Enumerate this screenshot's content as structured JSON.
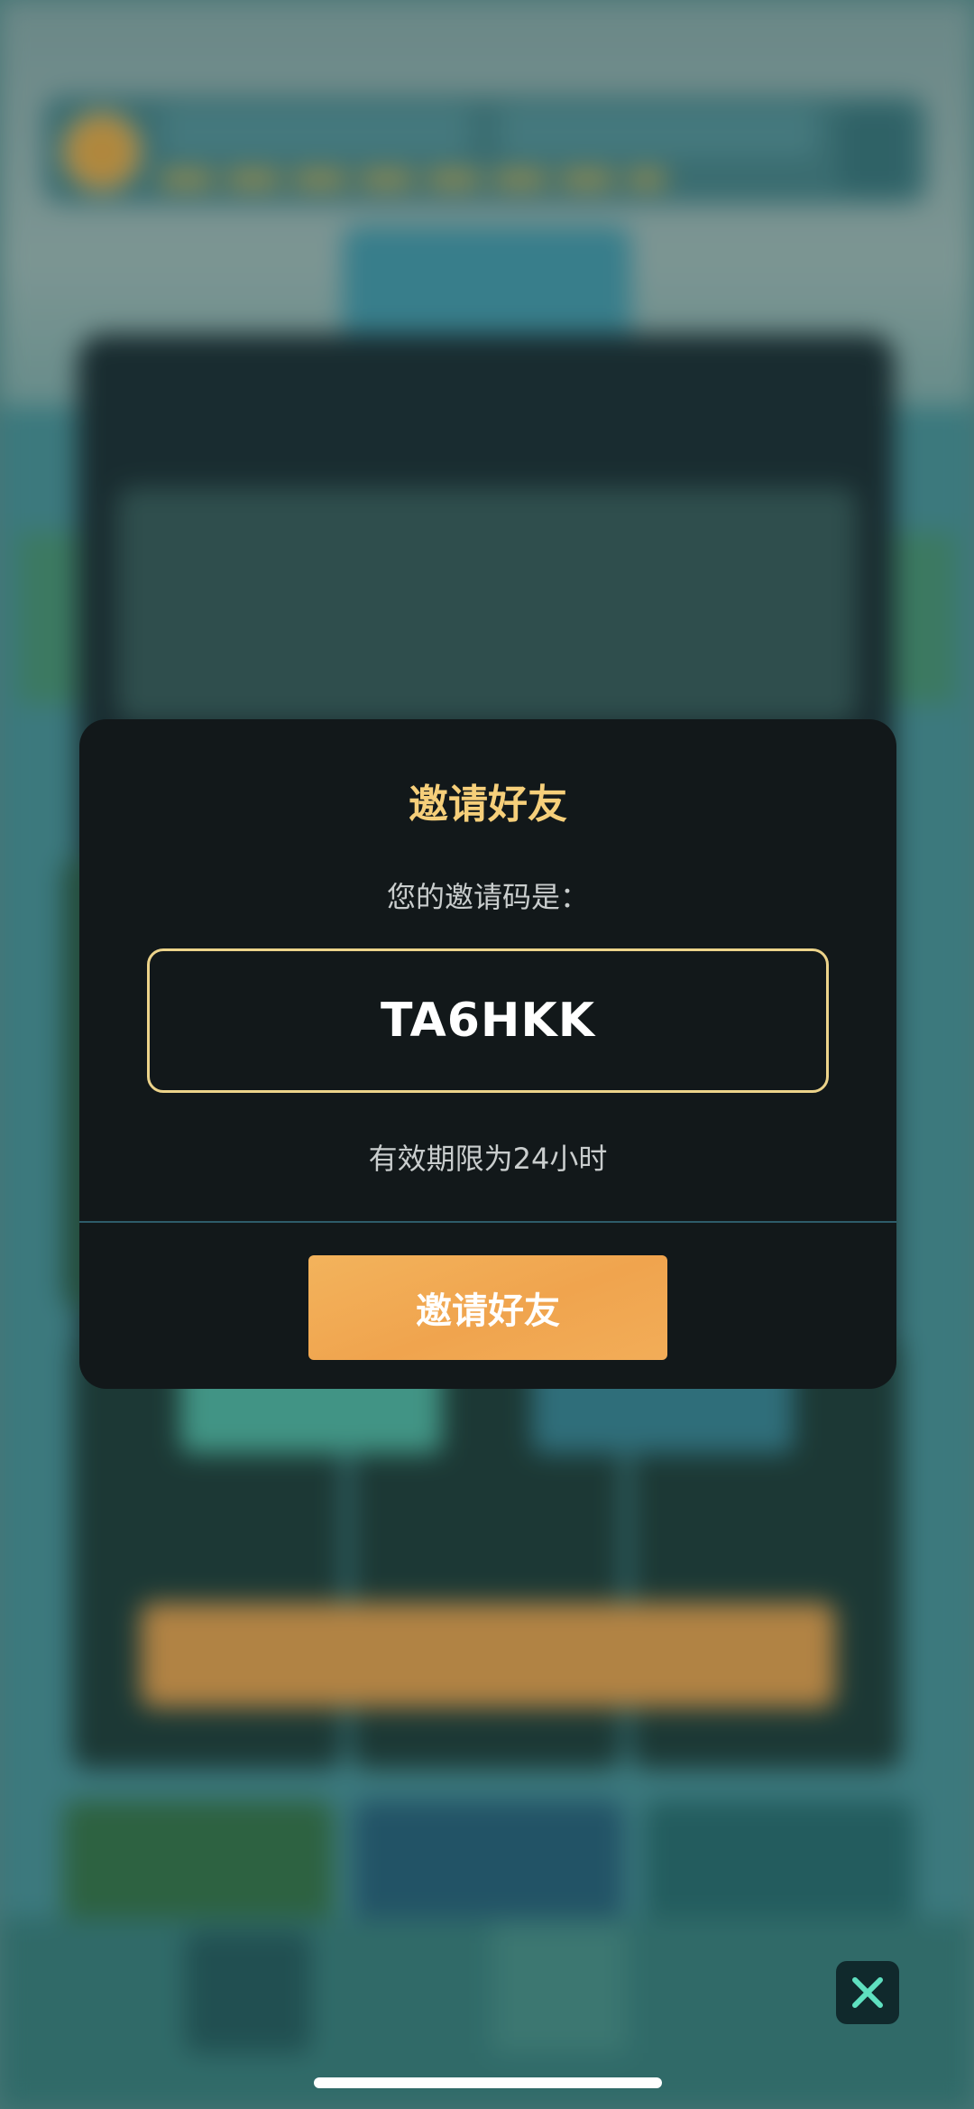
{
  "dialog": {
    "title": "邀请好友",
    "subtitle": "您的邀请码是：",
    "invite_code": "TA6HKK",
    "validity": "有效期限为24小时",
    "button_label": "邀请好友"
  },
  "colors": {
    "title": "#f6cf7a",
    "code_border": "#ecd38a",
    "button": "#f0a44e",
    "dialog_bg": "#12181a",
    "close_icon": "#5fe0c0"
  },
  "icons": {
    "close": "close-icon"
  }
}
